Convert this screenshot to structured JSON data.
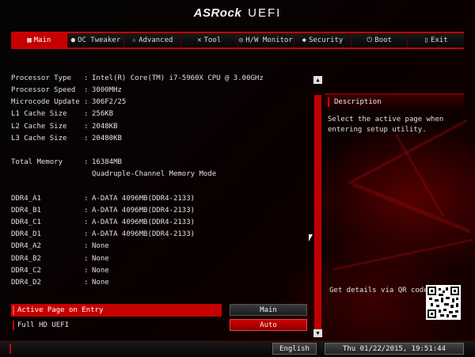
{
  "brand": {
    "logo": "ASRock",
    "suffix": "UEFI"
  },
  "tabs": [
    {
      "label": "Main",
      "icon": "▦",
      "icon_name": "main-grid-icon",
      "active": true
    },
    {
      "label": "OC Tweaker",
      "icon": "●",
      "icon_name": "oc-tweaker-icon",
      "active": false
    },
    {
      "label": "Advanced",
      "icon": "☆",
      "icon_name": "advanced-star-icon",
      "active": false
    },
    {
      "label": "Tool",
      "icon": "✕",
      "icon_name": "tool-wrench-icon",
      "active": false
    },
    {
      "label": "H/W Monitor",
      "icon": "◎",
      "icon_name": "hw-monitor-icon",
      "active": false
    },
    {
      "label": "Security",
      "icon": "◆",
      "icon_name": "security-shield-icon",
      "active": false
    },
    {
      "label": "Boot",
      "icon": "⏻",
      "icon_name": "boot-power-icon",
      "active": false
    },
    {
      "label": "Exit",
      "icon": "▯",
      "icon_name": "exit-door-icon",
      "active": false
    }
  ],
  "info": {
    "processor_type": {
      "label": "Processor Type",
      "value": "Intel(R) Core(TM) i7-5960X CPU @ 3.00GHz"
    },
    "processor_speed": {
      "label": "Processor Speed",
      "value": "3000MHz"
    },
    "microcode": {
      "label": "Microcode Update",
      "value": "306F2/25"
    },
    "l1": {
      "label": "L1 Cache Size",
      "value": "256KB"
    },
    "l2": {
      "label": "L2 Cache Size",
      "value": "2048KB"
    },
    "l3": {
      "label": "L3 Cache Size",
      "value": "20480KB"
    },
    "memory": {
      "label": "Total Memory",
      "value": "16384MB",
      "detail": "Quadruple-Channel Memory Mode"
    }
  },
  "dimms": [
    {
      "label": "DDR4_A1",
      "value": "A-DATA 4096MB(DDR4-2133)"
    },
    {
      "label": "DDR4_B1",
      "value": "A-DATA 4096MB(DDR4-2133)"
    },
    {
      "label": "DDR4_C1",
      "value": "A-DATA 4096MB(DDR4-2133)"
    },
    {
      "label": "DDR4_D1",
      "value": "A-DATA 4096MB(DDR4-2133)"
    },
    {
      "label": "DDR4_A2",
      "value": "None"
    },
    {
      "label": "DDR4_B2",
      "value": "None"
    },
    {
      "label": "DDR4_C2",
      "value": "None"
    },
    {
      "label": "DDR4_D2",
      "value": "None"
    }
  ],
  "separator": ":",
  "settings": [
    {
      "label": "Active Page on Entry",
      "value": "Main",
      "selected": true
    },
    {
      "label": "Full HD UEFI",
      "value": "Auto",
      "selected": false
    }
  ],
  "description": {
    "title": "Description",
    "text": "Select the active page when entering setup utility."
  },
  "qr_label": "Get details via QR code",
  "status": {
    "language": "English",
    "datetime": "Thu 01/22/2015, 19:51:44"
  },
  "colors": {
    "accent": "#c60000",
    "background": "#000000",
    "text": "#e6e6e6"
  }
}
